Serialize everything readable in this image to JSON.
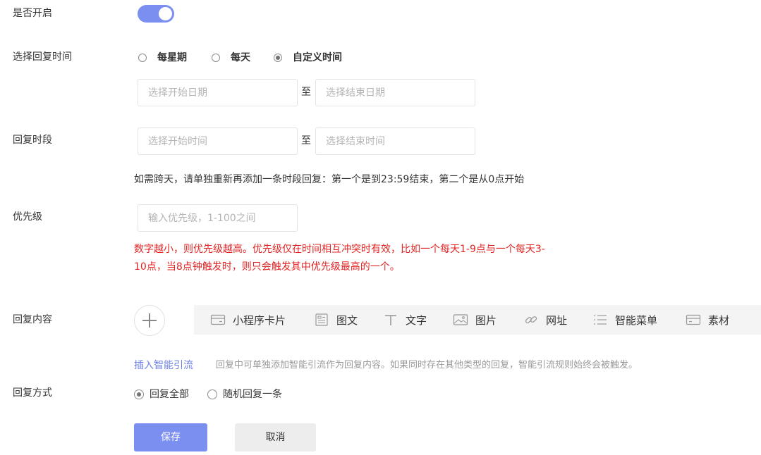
{
  "enable": {
    "label": "是否开启",
    "on": true
  },
  "reply_time": {
    "label": "选择回复时间",
    "options": [
      "每星期",
      "每天",
      "自定义时间"
    ],
    "selected": "自定义时间",
    "start_date_placeholder": "选择开始日期",
    "end_date_placeholder": "选择结束日期",
    "separator": "至"
  },
  "reply_period": {
    "label": "回复时段",
    "start_time_placeholder": "选择开始时间",
    "end_time_placeholder": "选择结束时间",
    "separator": "至",
    "hint": "如需跨天，请单独重新再添加一条时段回复：第一个是到23:59结束，第二个是从0点开始"
  },
  "priority": {
    "label": "优先级",
    "placeholder": "输入优先级，1-100之间",
    "warning_line1": "数字越小，则优先级越高。优先级仅在时间相互冲突时有效，比如一个每天1-9点与一个每天3-",
    "warning_line2": "10点，当8点钟触发时，则只会触发其中优先级最高的一个。"
  },
  "reply_content": {
    "label": "回复内容",
    "tools": [
      {
        "icon": "mini-program-card-icon",
        "label": "小程序卡片"
      },
      {
        "icon": "article-icon",
        "label": "图文"
      },
      {
        "icon": "text-icon",
        "label": "文字"
      },
      {
        "icon": "image-icon",
        "label": "图片"
      },
      {
        "icon": "link-icon",
        "label": "网址"
      },
      {
        "icon": "menu-list-icon",
        "label": "智能菜单"
      },
      {
        "icon": "material-icon",
        "label": "素材"
      }
    ],
    "insert_link": "插入智能引流",
    "insert_desc": "回复中可单独添加智能引流作为回复内容。如果同时存在其他类型的回复，智能引流规则始终会被触发。"
  },
  "reply_mode": {
    "label": "回复方式",
    "options": [
      "回复全部",
      "随机回复一条"
    ],
    "selected": "回复全部"
  },
  "buttons": {
    "save": "保存",
    "cancel": "取消"
  },
  "colors": {
    "accent": "#7b8ff0",
    "warning": "#e02424",
    "link": "#6f82e6"
  }
}
